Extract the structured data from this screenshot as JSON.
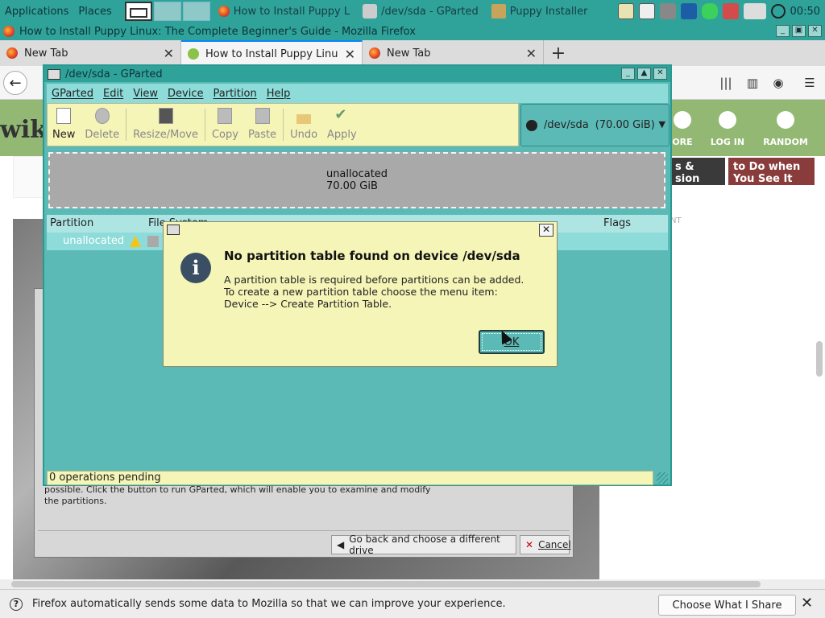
{
  "top_panel": {
    "menu_applications": "Applications",
    "menu_places": "Places",
    "tasks": [
      {
        "label": "How to Install Puppy L"
      },
      {
        "label": "/dev/sda - GParted"
      },
      {
        "label": "Puppy Installer"
      }
    ],
    "clock": "00:50"
  },
  "firefox": {
    "window_title": "How to Install Puppy Linux: The Complete Beginner's Guide - Mozilla Firefox",
    "tabs": [
      {
        "label": "New Tab"
      },
      {
        "label": "How to Install Puppy Linux"
      },
      {
        "label": "New Tab"
      }
    ],
    "notification": {
      "text": "Firefox automatically sends some data to Mozilla so that we can improve your experience.",
      "button": "Choose What I Share"
    }
  },
  "webpage": {
    "logo": "wik",
    "nav_items": [
      {
        "label": "ORE"
      },
      {
        "label": "LOG IN"
      },
      {
        "label": "RANDOM"
      }
    ],
    "card1": "s &\nsion",
    "card2": "to Do when\nYou See It",
    "ad_label": "NT"
  },
  "installer": {
    "description": "possible. Click the button to run GParted, which will enable you to examine and modify\nthe partitions.",
    "back_button": "Go back and choose a different drive",
    "cancel_button": "Cancel"
  },
  "gparted": {
    "title": "/dev/sda - GParted",
    "menu": [
      "GParted",
      "Edit",
      "View",
      "Device",
      "Partition",
      "Help"
    ],
    "toolbar": {
      "new": "New",
      "delete": "Delete",
      "resize": "Resize/Move",
      "copy": "Copy",
      "paste": "Paste",
      "undo": "Undo",
      "apply": "Apply"
    },
    "device": "/dev/sda",
    "device_size": "(70.00 GiB)",
    "disk_label": "unallocated",
    "disk_size": "70.00 GiB",
    "columns": {
      "partition": "Partition",
      "filesystem": "File System",
      "flags": "Flags"
    },
    "row": {
      "partition": "unallocated"
    },
    "status": "0 operations pending"
  },
  "dialog": {
    "heading": "No partition table found on device /dev/sda",
    "body_line1": "A partition table is required before partitions can be added.",
    "body_line2": "To create a new partition table choose the menu item:",
    "body_line3": "Device --> Create Partition Table.",
    "ok": "OK"
  }
}
